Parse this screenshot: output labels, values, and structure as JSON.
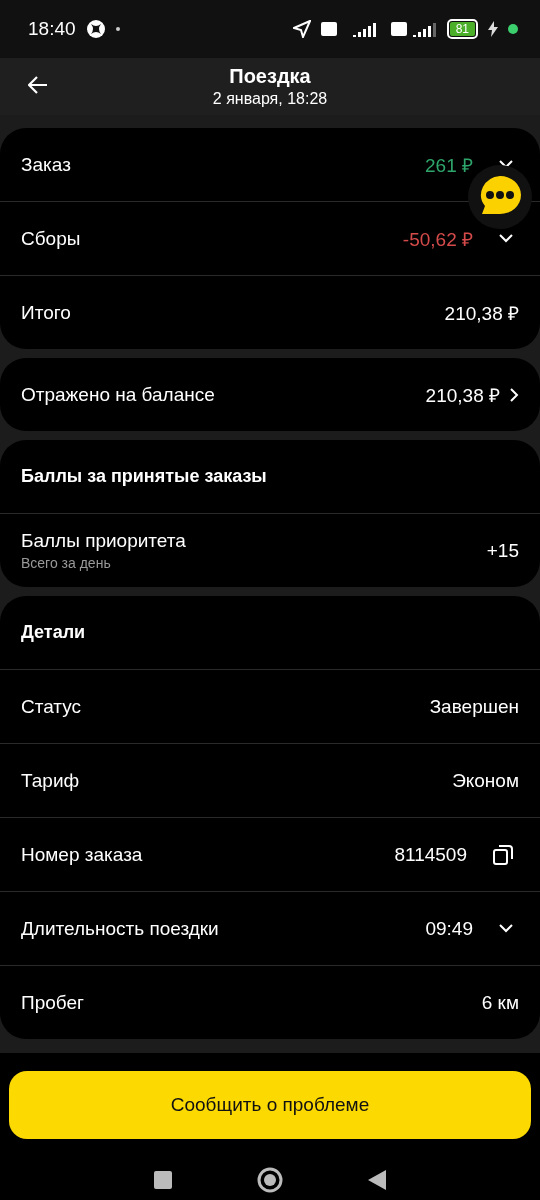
{
  "status_bar": {
    "time": "18:40",
    "battery": "81"
  },
  "header": {
    "title": "Поездка",
    "subtitle": "2 января, 18:28"
  },
  "cards": [
    {
      "rows": [
        {
          "kind": "income",
          "label": "Заказ",
          "value": "261 ₽",
          "expandable": true
        },
        {
          "kind": "fee",
          "label": "Сборы",
          "value": "-50,62 ₽",
          "expandable": true
        },
        {
          "kind": "plain",
          "label": "Итого",
          "value": "210,38 ₽"
        }
      ]
    },
    {
      "rows": [
        {
          "kind": "plain",
          "label": "Отражено на балансе",
          "value": "210,38 ₽",
          "navigates": true
        }
      ]
    },
    {
      "heading": "Баллы за принятые заказы",
      "rows": [
        {
          "kind": "plain",
          "label": "Баллы приоритета",
          "sublabel": "Всего за день",
          "value": "+15"
        }
      ]
    },
    {
      "heading": "Детали",
      "rows": [
        {
          "kind": "plain",
          "label": "Статус",
          "value": "Завершен"
        },
        {
          "kind": "plain",
          "label": "Тариф",
          "value": "Эконом"
        },
        {
          "kind": "plain",
          "label": "Номер заказа",
          "value": "8114509",
          "copyable": true
        },
        {
          "kind": "plain",
          "label": "Длительность поездки",
          "value": "09:49",
          "expandable": true
        },
        {
          "kind": "plain",
          "label": "Пробег",
          "value": "6 км"
        }
      ]
    }
  ],
  "report_button": "Сообщить о проблеме"
}
